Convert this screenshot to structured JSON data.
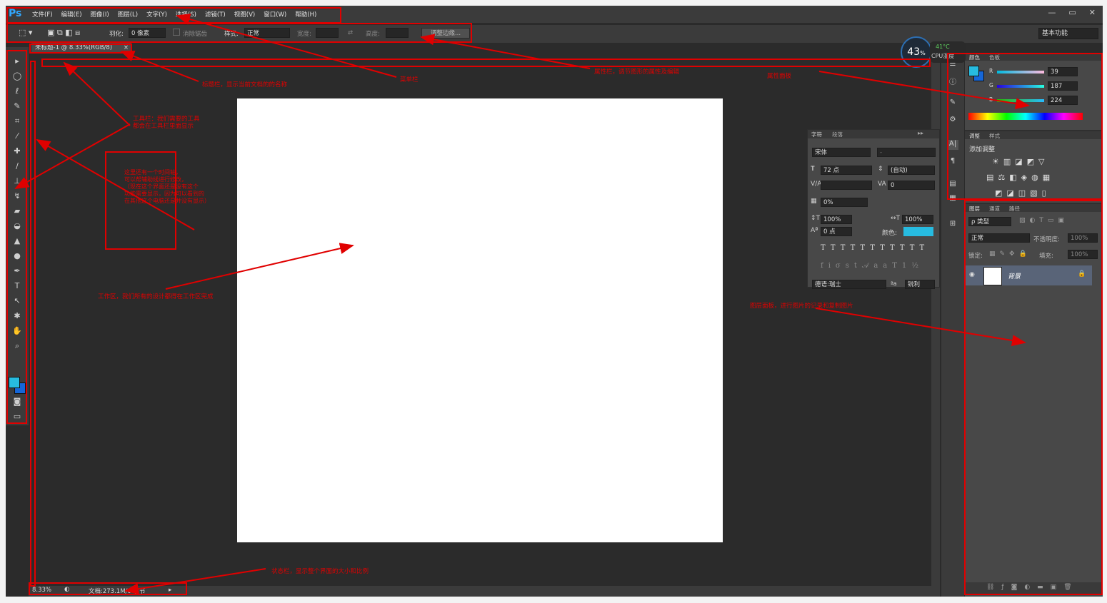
{
  "app": {
    "logo": "Ps"
  },
  "menu": [
    "文件(F)",
    "编辑(E)",
    "图像(I)",
    "图层(L)",
    "文字(Y)",
    "选择(S)",
    "滤镜(T)",
    "视图(V)",
    "窗口(W)",
    "帮助(H)"
  ],
  "window_controls": [
    "—",
    "▭",
    "✕"
  ],
  "options": {
    "feather_label": "羽化:",
    "feather_value": "0 像素",
    "antialias_label": "消除锯齿",
    "style_label": "样式:",
    "style_value": "正常",
    "width_label": "宽度:",
    "height_label": "高度:",
    "refine_edge": "调整边缘...",
    "workspace": "基本功能"
  },
  "document_tab": "未标题-1 @ 8.33%(RGB/8)",
  "document_tab_close": "×",
  "status": {
    "zoom": "8.33%",
    "doc": "文档:273.1M/0 字节"
  },
  "cpu": {
    "usage": "43",
    "unit": "%",
    "temp": "41°C",
    "label": "CPU温度"
  },
  "color_panel": {
    "tabs": [
      "颜色",
      "色板"
    ],
    "r_label": "R",
    "g_label": "G",
    "b_label": "B",
    "r": "39",
    "g": "187",
    "b": "224",
    "foreground": "#27bbe0"
  },
  "adjust_panel": {
    "tabs": [
      "调整",
      "样式"
    ],
    "title": "添加调整"
  },
  "layers_panel": {
    "tabs": [
      "图层",
      "通道",
      "路径"
    ],
    "filter": "ρ 类型",
    "blend": "正常",
    "opacity_label": "不透明度:",
    "opacity": "100%",
    "lock_label": "锁定:",
    "fill_label": "填充:",
    "fill": "100%",
    "layer_name": "背景"
  },
  "char_panel": {
    "tabs": [
      "字符",
      "段落"
    ],
    "font": "宋体",
    "font_style": "-",
    "size": "72 点",
    "leading": "(自动)",
    "tracking": "0",
    "scale_pct": "0%",
    "vscale": "100%",
    "hscale": "100%",
    "baseline": "0 点",
    "color_label": "颜色:",
    "color": "#27bbe0",
    "lang": "德语:瑞士",
    "aa_label": "ªa",
    "aa": "锐利"
  },
  "annotations": {
    "title_bar": "标题栏，显示当前文档的的名称",
    "menu_bar": "菜单栏",
    "options_bar": "属性栏，调节图形的属性及编辑",
    "props_panel": "属性面板",
    "toolbar": "工具栏：我们需要的工具\n都会在工具栏里面显示",
    "tips": "这里还有一个时间轴，\n可以帮辅助线进行修改，\n（现在这个界面还是没有这个\n功能需要显示，因为可以看到的\n在其他这个电脑还是并没有显示）",
    "workspace": "工作区，我们所有的设计都得在工作区完成",
    "layers": "图层面板，进行图片的记录和复制图片",
    "status_bar": "状态栏，显示整个界面的大小和比例"
  }
}
